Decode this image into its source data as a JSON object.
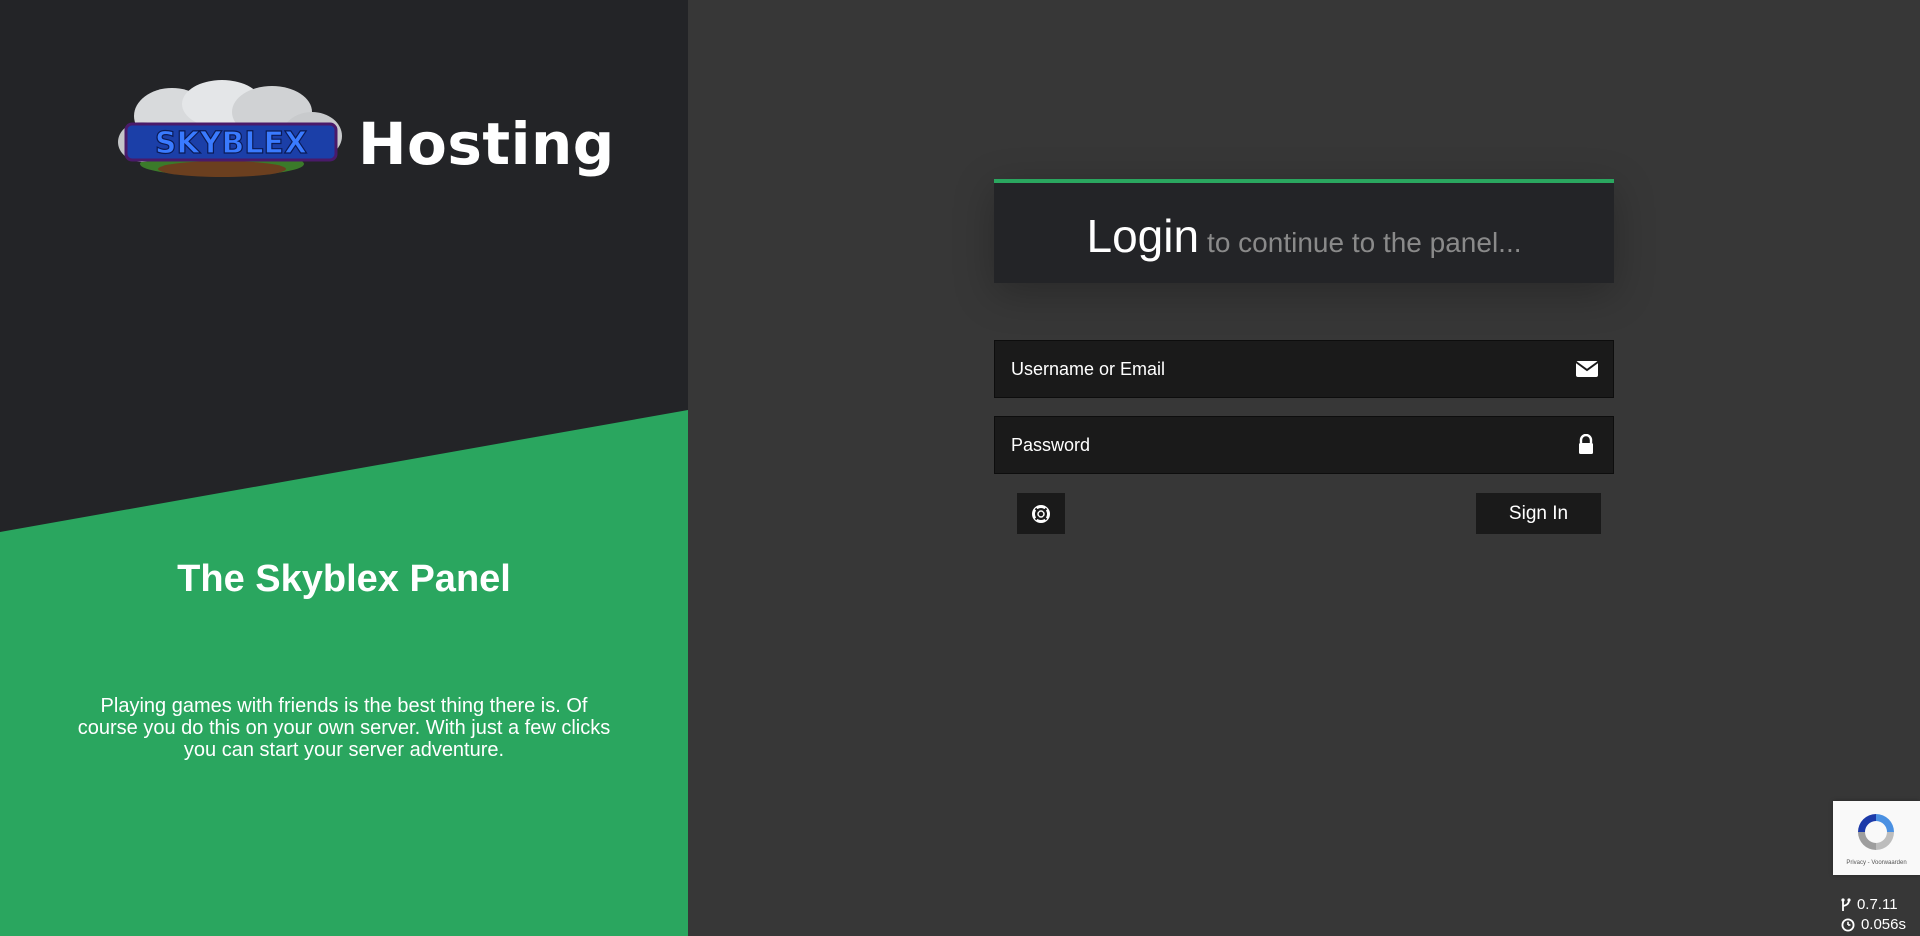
{
  "brand": {
    "name": "Hosting",
    "logo_text": "SKYBLEX"
  },
  "left": {
    "title": "The Skyblex Panel",
    "description": "Playing games with friends is the best thing there is. Of course you do this on your own server. With just a few clicks you can start your server adventure."
  },
  "login": {
    "title": "Login",
    "subtitle": "to continue to the panel...",
    "username_placeholder": "Username or Email",
    "password_placeholder": "Password",
    "signin_label": "Sign In"
  },
  "recaptcha": {
    "text": "Privacy - Voorwaarden"
  },
  "footer": {
    "version": "0.7.11",
    "time": "0.056s"
  },
  "colors": {
    "accent": "#2aa65f",
    "left_bg": "#232427",
    "page_bg": "#373737"
  },
  "icons": {
    "username": "envelope-icon",
    "password": "lock-icon",
    "help": "life-ring-icon",
    "version": "code-fork-icon",
    "time": "clock-icon"
  }
}
